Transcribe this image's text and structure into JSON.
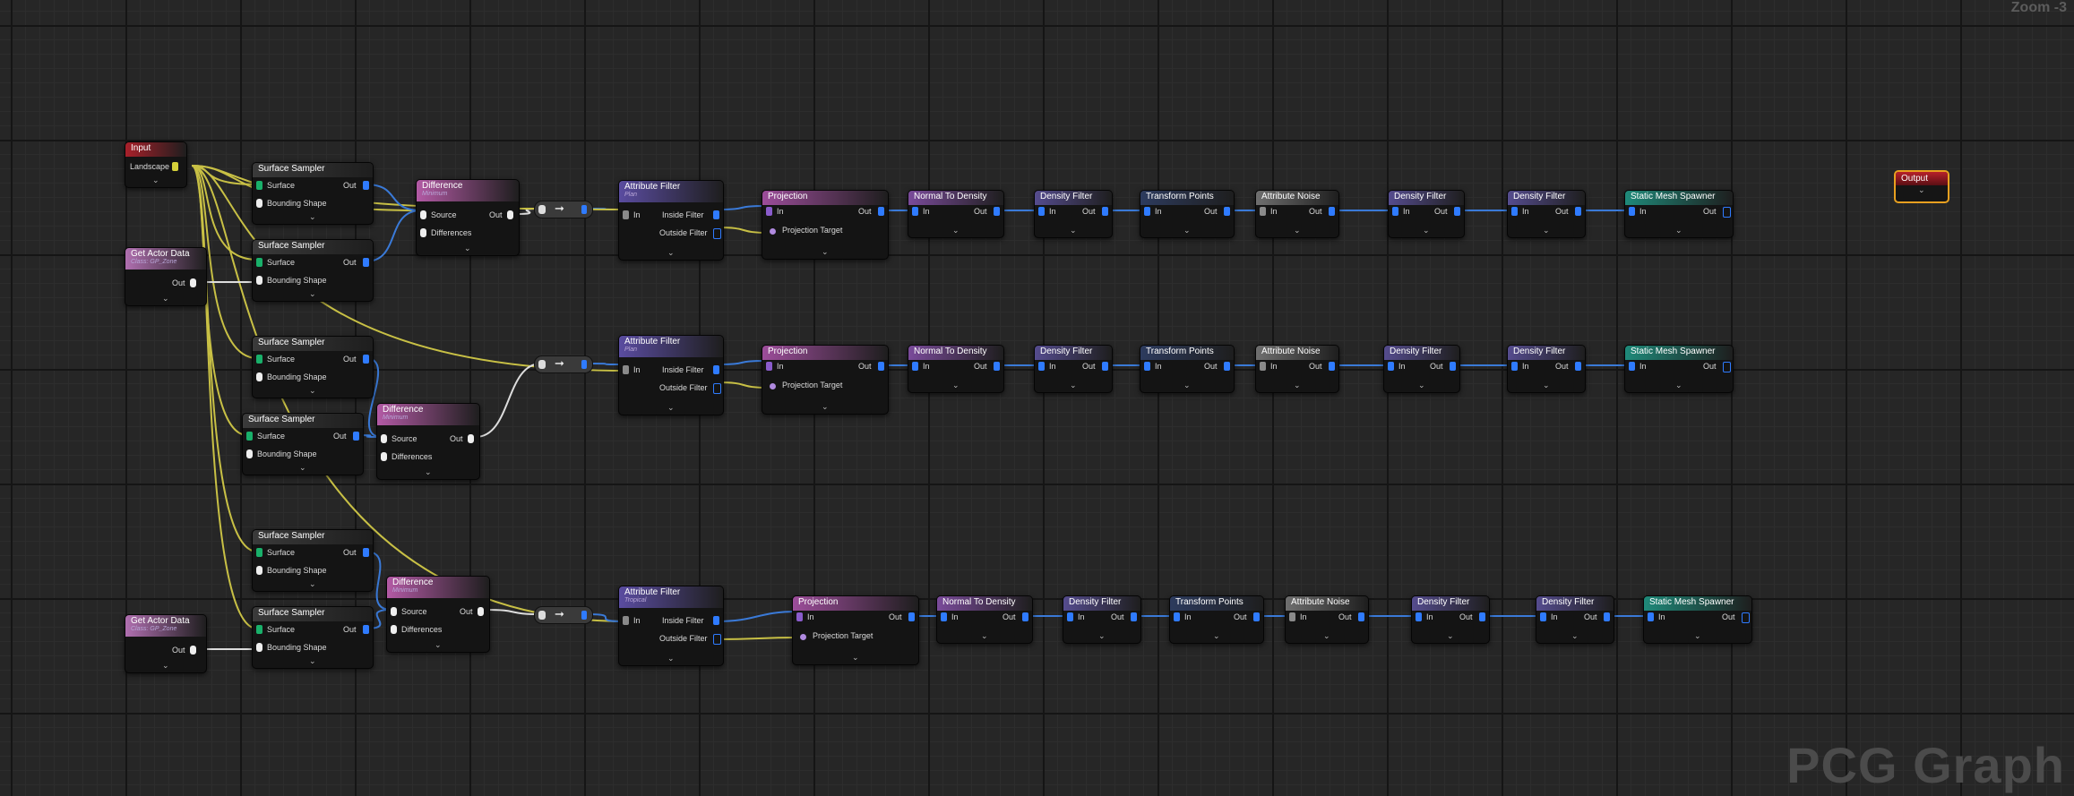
{
  "zoom_label": "Zoom -3",
  "watermark": "PCG Graph",
  "labels": {
    "in": "In",
    "out": "Out",
    "surface": "Surface",
    "bounding_shape": "Bounding Shape",
    "source": "Source",
    "differences": "Differences",
    "inside_filter": "Inside Filter",
    "outside_filter": "Outside Filter",
    "projection_target": "Projection Target",
    "landscape": "Landscape",
    "chevron": "⌄",
    "arrow": "➞"
  },
  "nodes": {
    "input": "Input",
    "get_actor_data": "Get Actor Data",
    "get_actor_data_sub": "Class: GP_Zone",
    "surface_sampler": "Surface Sampler",
    "difference": "Difference",
    "difference_sub": "Minimum",
    "attribute_filter": "Attribute Filter",
    "attribute_filter_sub_1": "Plan",
    "attribute_filter_sub_2": "Plan",
    "attribute_filter_sub_3": "Tropical",
    "projection": "Projection",
    "normal_to_density": "Normal To Density",
    "density_filter": "Density Filter",
    "transform_points": "Transform Points",
    "attribute_noise": "Attribute Noise",
    "static_mesh_spawner": "Static Mesh Spawner",
    "output": "Output"
  },
  "colors": {
    "input": "#a8202a",
    "get_actor_data": "#b06fb0",
    "surface_sampler": "#3a3a3a",
    "difference": "#b35aa5",
    "attribute_filter": "#5a4ca0",
    "projection": "#9c4d9a",
    "normal_to_density": "#7a4b9a",
    "density_filter": "#554c8e",
    "transform_points": "#2d3b5e",
    "attribute_noise": "#6f6f6f",
    "static_mesh_spawner": "#1f8a7a",
    "wire_yellow": "#c8c045",
    "wire_blue": "#3a7ad8",
    "wire_white": "#dddddd",
    "output_border": "#e8a020"
  }
}
